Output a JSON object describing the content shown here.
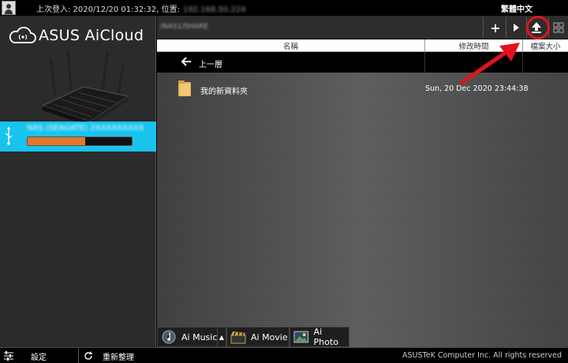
{
  "topbar": {
    "login_info": "上次登入: 2020/12/20 01:32:32, 位置:",
    "login_ip": "192.168.50.224",
    "language": "繁體中文"
  },
  "sidebar": {
    "logo_text": "ASUS AiCloud",
    "usb": {
      "name": "NAS (SEAGATE) 2XXXXXXXXX",
      "usage_fraction": 0.55
    }
  },
  "bottom": {
    "settings_label": "設定",
    "refresh_label": "重新整理",
    "copyright": "ASUSTeK Computer Inc. All rights reserved"
  },
  "main": {
    "path": "/NAS1/SHARE",
    "columns": [
      "名稱",
      "修改時間",
      "檔案大小"
    ],
    "up_label": "上一層",
    "files": [
      {
        "name": "我的新資料夾",
        "modified": "Sun, 20 Dec 2020 23:44:38",
        "size": ""
      }
    ],
    "apps": [
      "Ai Music",
      "Ai Movie",
      "Ai Photo"
    ]
  },
  "colors": {
    "accent": "#18c3ee",
    "usage_bar": "#e5772a",
    "annotation": "#e0141d"
  }
}
